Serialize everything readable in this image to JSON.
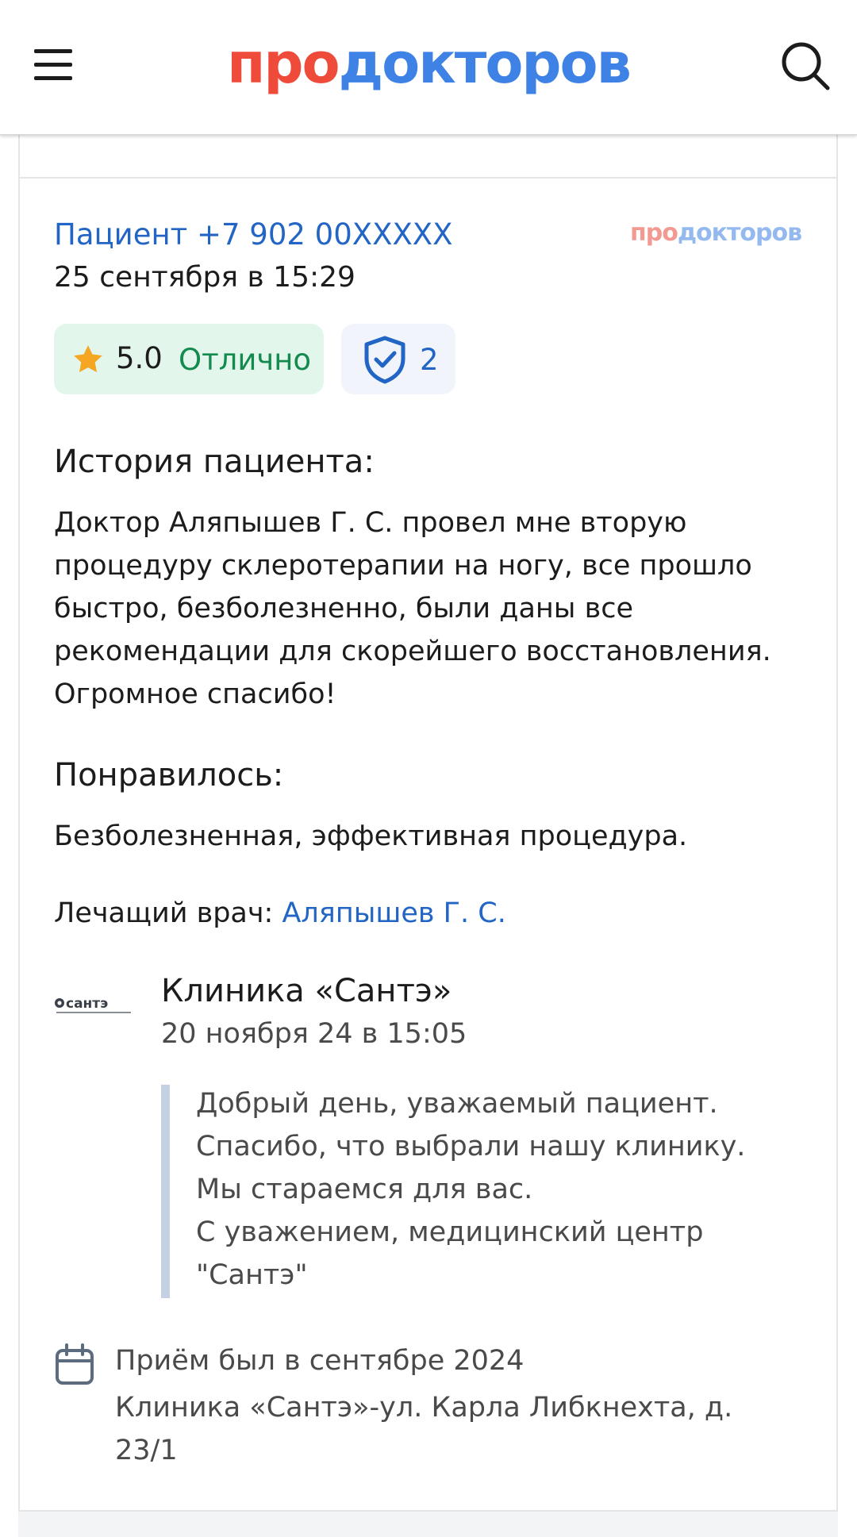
{
  "header": {
    "logo_part1": "про",
    "logo_part2": "докторов"
  },
  "review": {
    "author": "Пациент +7 902 00XXXXX",
    "date": "25 сентября в 15:29",
    "source_logo_part1": "про",
    "source_logo_part2": "докторов",
    "rating_value": "5.0",
    "rating_label": "Отлично",
    "verified_count": "2",
    "story_title": "История пациента:",
    "story_lines": [
      "Доктор Аляпышев Г. С. провел мне вторую",
      "процедуру склеротерапии на ногу, все прошло",
      "быстро, безболезненно, были даны все",
      "рекомендации для скорейшего восстановления.",
      "Огромное спасибо!"
    ],
    "liked_title": "Понравилось:",
    "liked_text": "Безболезненная, эффективная процедура.",
    "doctor_label": "Лечащий врач:",
    "doctor_name": "Аляпышев Г. С."
  },
  "clinic_reply": {
    "logo_text": "сантэ",
    "name": "Клиника «Сантэ»",
    "date": "20 ноября 24 в 15:05",
    "lines": [
      "Добрый день, уважаемый пациент.",
      "Спасибо, что выбрали нашу клинику.",
      "Мы стараемся для вас.",
      "С уважением, медицинский центр",
      "\"Сантэ\""
    ]
  },
  "visit": {
    "when": "Приём был в сентябре 2024",
    "where_line1": "Клиника «Сантэ»-ул. Карла Либкнехта, д.",
    "where_line2": "23/1"
  },
  "colors": {
    "link": "#2265c4",
    "logo_red": "#ee4b3b",
    "logo_blue": "#3f82e6",
    "rating_bg": "#e3f6ec",
    "rating_label": "#138a4e",
    "verified_bg": "#f1f5fb",
    "star": "#f5a623"
  },
  "icons": [
    "menu-icon",
    "search-icon",
    "star-icon",
    "shield-check-icon",
    "calendar-icon",
    "clinic-logo"
  ]
}
